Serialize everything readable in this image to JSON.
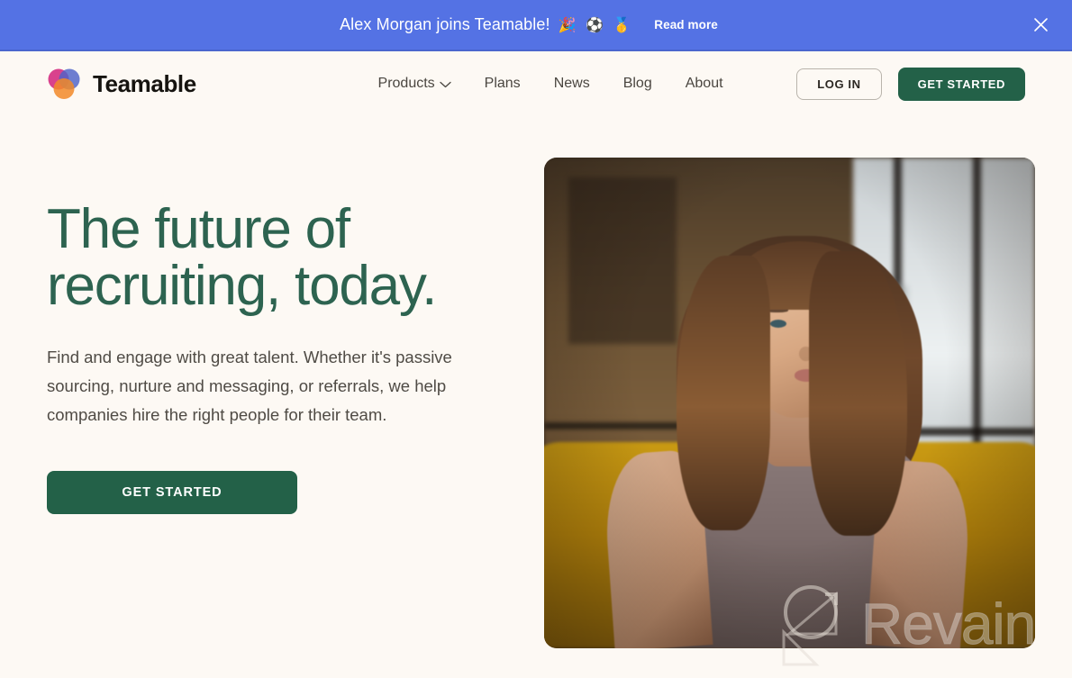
{
  "banner": {
    "text": "Alex Morgan joins Teamable!",
    "emojis": "🎉 ⚽ 🥇",
    "link_label": "Read more",
    "close_icon": "close-icon",
    "background_color": "#5472E4",
    "text_color": "#FFFFFF"
  },
  "header": {
    "brand": {
      "name": "Teamable",
      "logo_icon": "teamable-logo-three-circles",
      "logo_colors": {
        "magenta": "#D4287E",
        "blue": "#4E63C8",
        "orange": "#F28A28"
      }
    },
    "nav": [
      {
        "label": "Products",
        "has_dropdown": true,
        "icon": "chevron-down-icon"
      },
      {
        "label": "Plans",
        "has_dropdown": false
      },
      {
        "label": "News",
        "has_dropdown": false
      },
      {
        "label": "Blog",
        "has_dropdown": false
      },
      {
        "label": "About",
        "has_dropdown": false
      }
    ],
    "login_label": "LOG IN",
    "get_started_label": "GET STARTED"
  },
  "hero": {
    "title": "The future of recruiting, today.",
    "subtitle": "Find and engage with great talent. Whether it's passive sourcing, nurture and messaging, or referrals, we help companies hire the right people for their team.",
    "cta_label": "GET STARTED",
    "image_alt": "Woman with long brown hair in a grey knit top seated in a mustard yellow chair during an interview"
  },
  "watermark": {
    "text": "Revain",
    "icon": "revain-logo-icon"
  },
  "theme": {
    "page_background": "#FDF9F4",
    "brand_green": "#236148",
    "heading_green": "#2D6350",
    "banner_blue": "#5472E4",
    "body_text": "#4F4B45"
  }
}
